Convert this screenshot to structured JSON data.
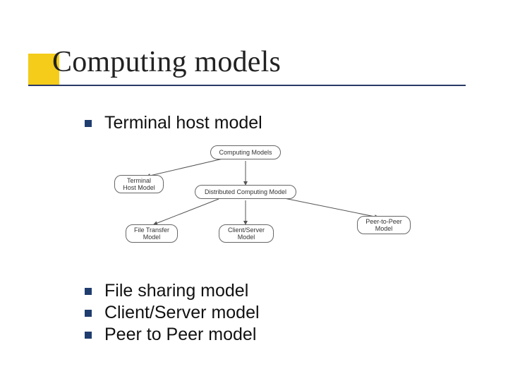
{
  "title": "Computing models",
  "bullets": {
    "top": "Terminal host model",
    "bottom": [
      "File sharing model",
      "Client/Server model",
      "Peer to Peer model"
    ]
  },
  "diagram": {
    "nodes": {
      "root": "Computing Models",
      "terminal": "Terminal\nHost Model",
      "distributed": "Distributed Computing Model",
      "file": "File Transfer\nModel",
      "clientserver": "Client/Server\nModel",
      "p2p": "Peer-to-Peer\nModel"
    }
  }
}
